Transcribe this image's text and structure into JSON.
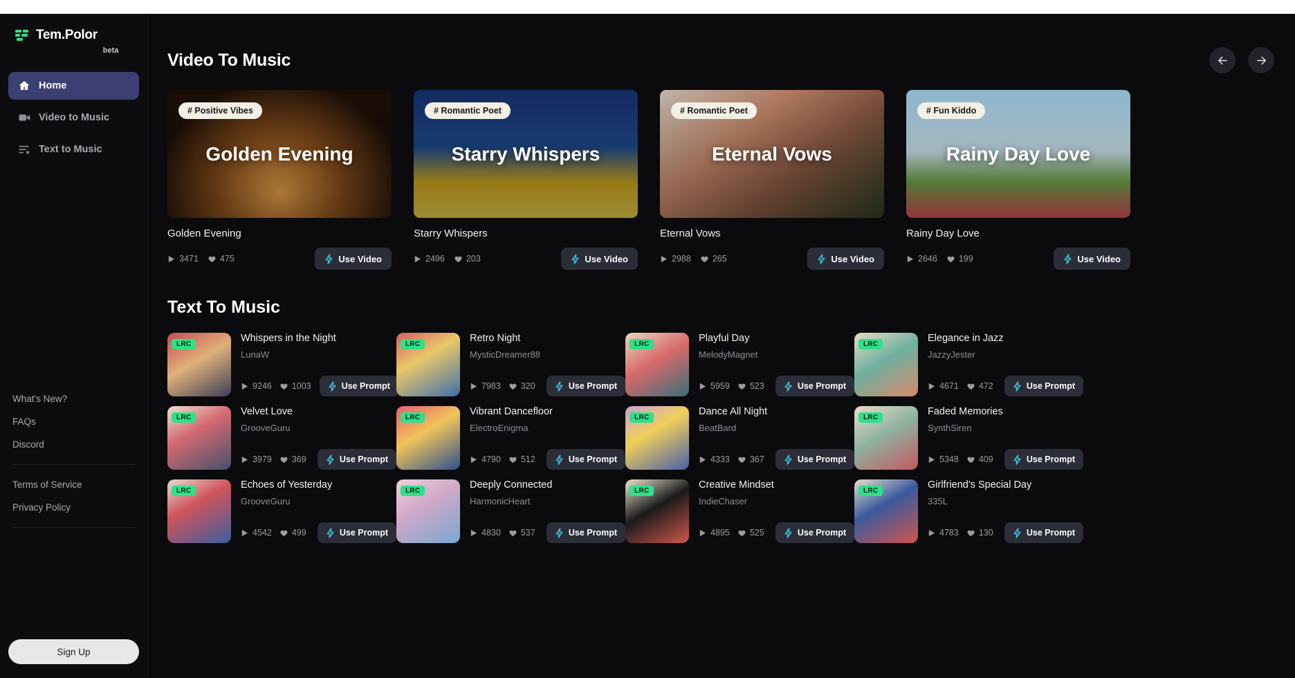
{
  "brand": {
    "name": "Tem.Polor",
    "suffix": "beta"
  },
  "sidebar": {
    "nav": [
      {
        "label": "Home",
        "icon": "home-icon",
        "active": true
      },
      {
        "label": "Video to Music",
        "icon": "video-camera-icon",
        "active": false
      },
      {
        "label": "Text to Music",
        "icon": "text-lines-icon",
        "active": false
      }
    ],
    "links": [
      "What's New?",
      "FAQs",
      "Discord"
    ],
    "legal": [
      "Terms of Service",
      "Privacy Policy"
    ],
    "signup_label": "Sign Up"
  },
  "video_section": {
    "title": "Video To Music",
    "prev_label": "←",
    "next_label": "→",
    "use_label": "Use Video",
    "cards": [
      {
        "tag": "# Positive Vibes",
        "overlay": "Golden Evening",
        "title": "Golden Evening",
        "plays": "3471",
        "likes": "475"
      },
      {
        "tag": "# Romantic Poet",
        "overlay": "Starry Whispers",
        "title": "Starry Whispers",
        "plays": "2496",
        "likes": "203"
      },
      {
        "tag": "# Romantic Poet",
        "overlay": "Eternal Vows",
        "title": "Eternal Vows",
        "plays": "2988",
        "likes": "265"
      },
      {
        "tag": "# Fun Kiddo",
        "overlay": "Rainy Day Love",
        "title": "Rainy Day Love",
        "plays": "2646",
        "likes": "199"
      }
    ]
  },
  "text_section": {
    "title": "Text To Music",
    "use_label": "Use Prompt",
    "badge": "LRC",
    "items": [
      {
        "title": "Whispers in the Night",
        "artist": "LunaW",
        "plays": "9246",
        "likes": "1003"
      },
      {
        "title": "Retro Night",
        "artist": "MysticDreamer88",
        "plays": "7983",
        "likes": "320"
      },
      {
        "title": "Playful Day",
        "artist": "MelodyMagnet",
        "plays": "5959",
        "likes": "523"
      },
      {
        "title": "Elegance in Jazz",
        "artist": "JazzyJester",
        "plays": "4671",
        "likes": "472"
      },
      {
        "title": "Velvet Love",
        "artist": "GrooveGuru",
        "plays": "3979",
        "likes": "369"
      },
      {
        "title": "Vibrant Dancefloor",
        "artist": "ElectroEnigma",
        "plays": "4790",
        "likes": "512"
      },
      {
        "title": "Dance All Night",
        "artist": "BeatBard",
        "plays": "4333",
        "likes": "367"
      },
      {
        "title": "Faded Memories",
        "artist": "SynthSiren",
        "plays": "5348",
        "likes": "409"
      },
      {
        "title": "Echoes of Yesterday",
        "artist": "GrooveGuru",
        "plays": "4542",
        "likes": "499"
      },
      {
        "title": "Deeply Connected",
        "artist": "HarmonicHeart",
        "plays": "4830",
        "likes": "537"
      },
      {
        "title": "Creative Mindset",
        "artist": "IndieChaser",
        "plays": "4895",
        "likes": "525"
      },
      {
        "title": "Girlfriend's Special Day",
        "artist": "335L",
        "plays": "4783",
        "likes": "130"
      }
    ]
  },
  "colors": {
    "background": "#0b0b0d",
    "sidebar": "#0d0d0f",
    "active_nav": "#3b3f72",
    "accent_cyan": "#3ec6e0",
    "lrc_green": "#2fe08a",
    "tag_cream": "#f2f0e4"
  }
}
